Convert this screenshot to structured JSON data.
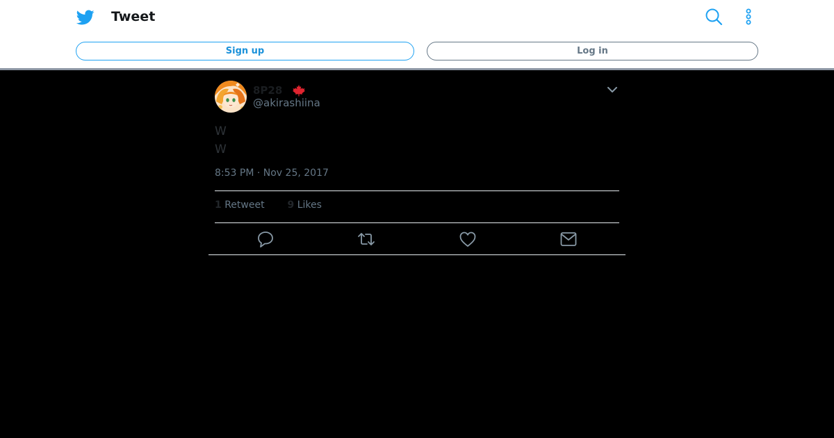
{
  "header": {
    "title": "Tweet",
    "signup_label": "Sign up",
    "login_label": "Log in",
    "icons": [
      "twitter-bird-icon",
      "search-icon",
      "more-vertical-icon"
    ]
  },
  "tweet": {
    "display_name": "8P28",
    "flag": "canada-flag",
    "handle": "@akirashiina",
    "text_lines": [
      "W",
      "W"
    ],
    "timestamp": "8:53 PM · Nov 25, 2017",
    "retweet_count": "1",
    "retweet_label": "Retweet",
    "like_count": "9",
    "like_label": "Likes",
    "actions": [
      "reply-icon",
      "retweet-icon",
      "like-icon",
      "share-message-icon"
    ]
  },
  "colors": {
    "brand": "#1da1f2",
    "muted": "#657786",
    "background": "#000000",
    "flag_red": "#e0242f"
  }
}
